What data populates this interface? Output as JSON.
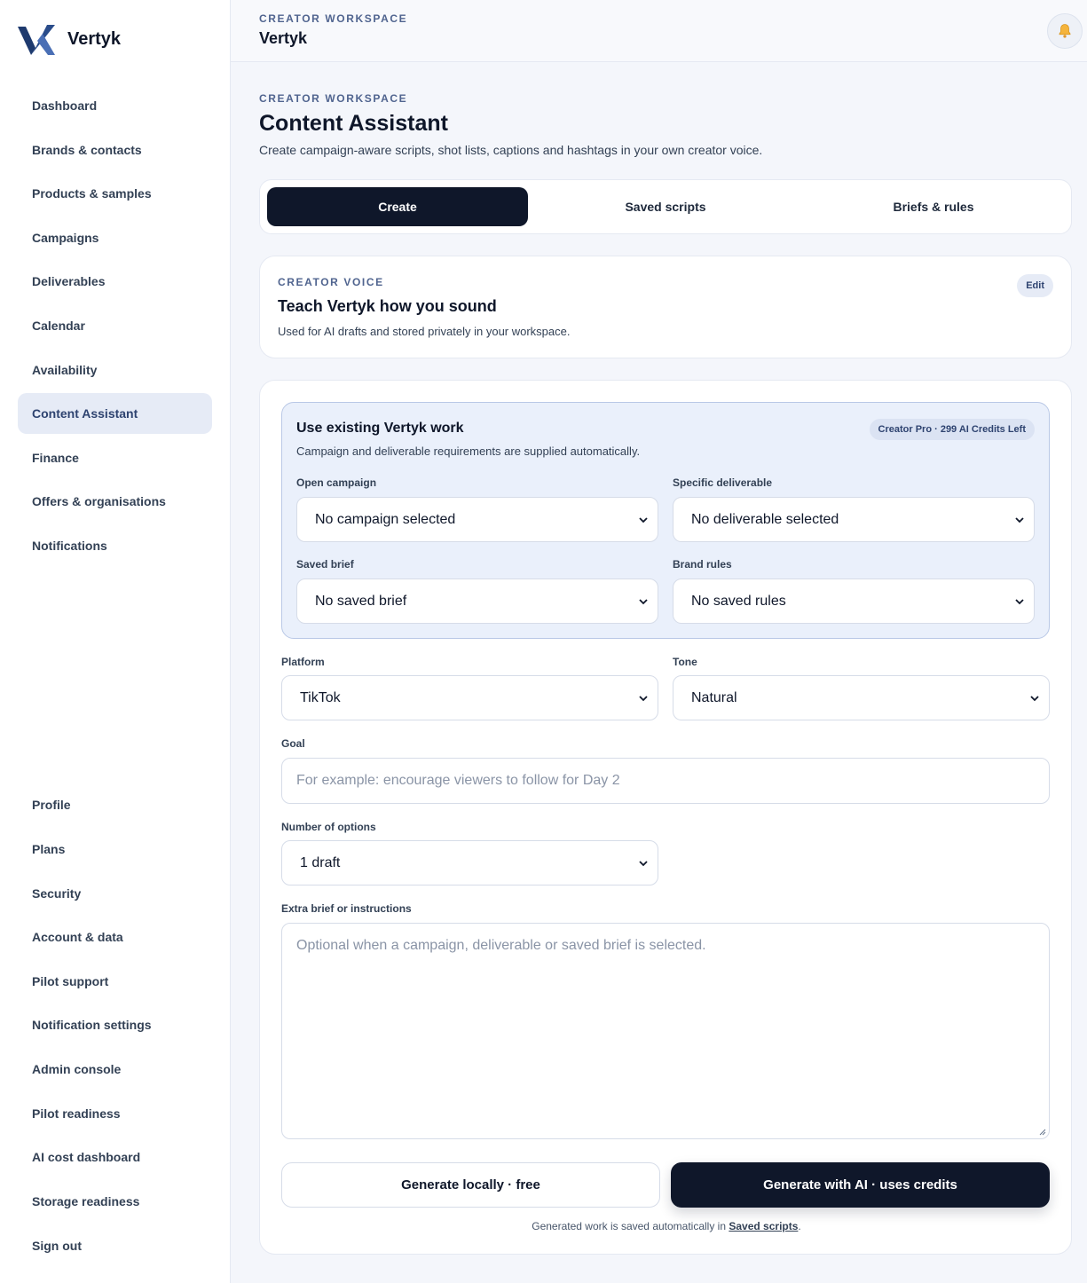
{
  "app": {
    "name": "Vertyk"
  },
  "sidebar": {
    "items": [
      {
        "label": "Dashboard"
      },
      {
        "label": "Brands & contacts"
      },
      {
        "label": "Products & samples"
      },
      {
        "label": "Campaigns"
      },
      {
        "label": "Deliverables"
      },
      {
        "label": "Calendar"
      },
      {
        "label": "Availability"
      },
      {
        "label": "Content Assistant",
        "active": true
      },
      {
        "label": "Finance"
      },
      {
        "label": "Offers & organisations"
      },
      {
        "label": "Notifications"
      }
    ],
    "bottom_items": [
      {
        "label": "Profile"
      },
      {
        "label": "Plans"
      },
      {
        "label": "Security"
      },
      {
        "label": "Account & data"
      },
      {
        "label": "Pilot support"
      },
      {
        "label": "Notification settings"
      },
      {
        "label": "Admin console"
      },
      {
        "label": "Pilot readiness"
      },
      {
        "label": "AI cost dashboard"
      },
      {
        "label": "Storage readiness"
      },
      {
        "label": "Sign out"
      }
    ]
  },
  "header": {
    "eyebrow": "CREATOR WORKSPACE",
    "title": "Vertyk",
    "bell_icon": "bell-icon"
  },
  "page": {
    "eyebrow": "CREATOR WORKSPACE",
    "title": "Content Assistant",
    "subtitle": "Create campaign-aware scripts, shot lists, captions and hashtags in your own creator voice."
  },
  "tabs": [
    {
      "label": "Create",
      "active": true
    },
    {
      "label": "Saved scripts"
    },
    {
      "label": "Briefs & rules"
    }
  ],
  "voice": {
    "eyebrow": "CREATOR VOICE",
    "title": "Teach Vertyk how you sound",
    "subtitle": "Used for AI drafts and stored privately in your workspace.",
    "edit_label": "Edit"
  },
  "existing": {
    "title": "Use existing Vertyk work",
    "subtitle": "Campaign and deliverable requirements are supplied automatically.",
    "badge": "Creator Pro · 299 AI Credits Left",
    "campaign": {
      "label": "Open campaign",
      "value": "No campaign selected"
    },
    "deliverable": {
      "label": "Specific deliverable",
      "value": "No deliverable selected"
    },
    "brief": {
      "label": "Saved brief",
      "value": "No saved brief"
    },
    "rules": {
      "label": "Brand rules",
      "value": "No saved rules"
    }
  },
  "form": {
    "platform": {
      "label": "Platform",
      "value": "TikTok"
    },
    "tone": {
      "label": "Tone",
      "value": "Natural"
    },
    "goal": {
      "label": "Goal",
      "placeholder": "For example: encourage viewers to follow for Day 2"
    },
    "options": {
      "label": "Number of options",
      "value": "1 draft"
    },
    "extra": {
      "label": "Extra brief or instructions",
      "placeholder": "Optional when a campaign, deliverable or saved brief is selected."
    }
  },
  "actions": {
    "local_label": "Generate locally · free",
    "ai_label": "Generate with AI · uses credits",
    "footnote_prefix": "Generated work is saved automatically in ",
    "footnote_link": "Saved scripts",
    "footnote_suffix": "."
  },
  "colors": {
    "accent_dark": "#0f172a",
    "accent_soft": "#e6ebf6",
    "brand_blue": "#2e4370"
  }
}
